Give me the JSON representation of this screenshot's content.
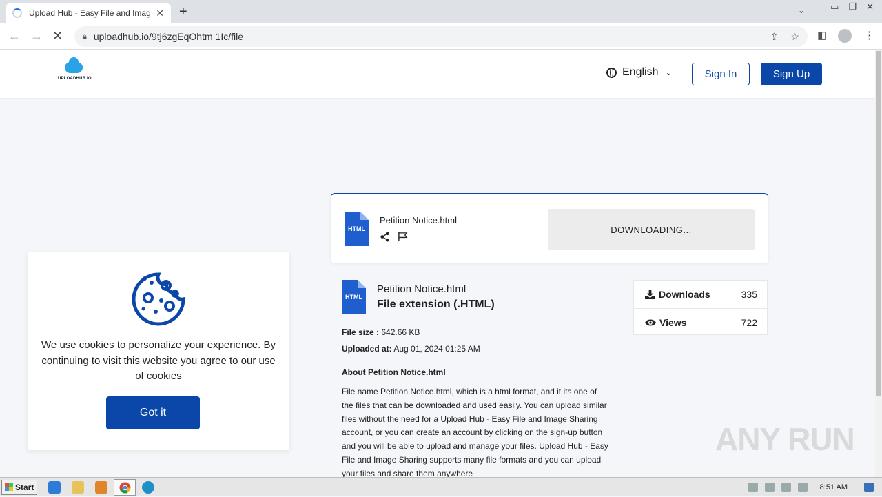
{
  "browser": {
    "tab_title": "Upload Hub - Easy File and Image Sh",
    "url": "uploadhub.io/9tj6zgEqOhtm 1Ic/file"
  },
  "header": {
    "logo_text": "UPLOADHUB.IO",
    "language": "English",
    "sign_in": "Sign In",
    "sign_up": "Sign Up"
  },
  "download_card": {
    "file_icon_label": "HTML",
    "file_name": "Petition Notice.html",
    "button_label": "DOWNLOADING..."
  },
  "file_info": {
    "file_icon_label": "HTML",
    "name": "Petition Notice.html",
    "extension": "File extension (.HTML)",
    "size_label": "File size :",
    "size_value": "642.66 KB",
    "uploaded_label": "Uploaded at:",
    "uploaded_value": "Aug 01, 2024 01:25 AM",
    "about_title": "About Petition Notice.html",
    "about_text": "File name Petition Notice.html, which is a html format, and it its one of the files that can be downloaded and used easily. You can upload similar files without the need for a Upload Hub - Easy File and Image Sharing account, or you can create an account by clicking on the sign-up button and you will be able to upload and manage your files. Upload Hub - Easy File and Image Sharing supports many file formats and you can upload your files and share them anywhere"
  },
  "stats": {
    "downloads_label": "Downloads",
    "downloads_value": "335",
    "views_label": "Views",
    "views_value": "722"
  },
  "cookie_banner": {
    "text": "We use cookies to personalize your experience. By continuing to visit this website you agree to our use of cookies",
    "button": "Got it"
  },
  "watermark": "ANY RUN",
  "taskbar": {
    "start": "Start",
    "clock": "8:51 AM"
  },
  "colors": {
    "primary": "#0b47a8",
    "file_icon": "#1f5ecf"
  }
}
